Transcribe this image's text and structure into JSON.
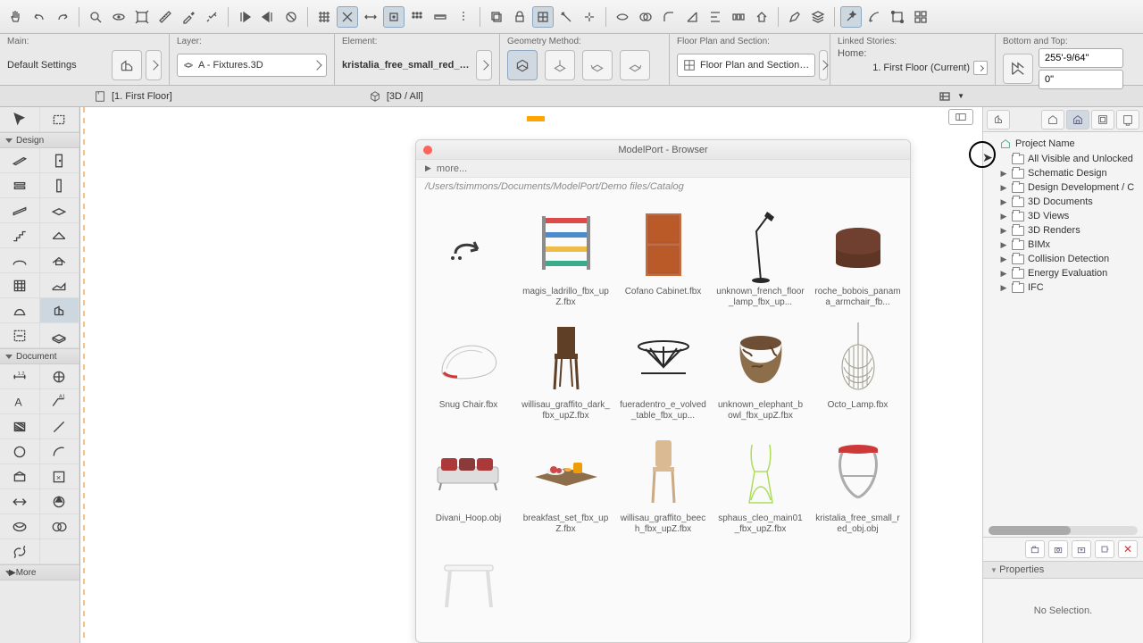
{
  "info": {
    "main_label": "Main:",
    "main_value": "Default Settings",
    "layer_label": "Layer:",
    "layer_value": "A - Fixtures.3D",
    "element_label": "Element:",
    "element_value": "kristalia_free_small_red_obj",
    "geometry_label": "Geometry Method:",
    "floorplan_label": "Floor Plan and Section:",
    "floorplan_value": "Floor Plan and Section…",
    "linked_label": "Linked Stories:",
    "linked_home": "Home:",
    "linked_story": "1. First Floor (Current)",
    "bottom_top_label": "Bottom and Top:",
    "top_value": "255'-9/64\"",
    "bottom_value": "0\""
  },
  "tabs": {
    "tab1": "[1. First Floor]",
    "tab2": "[3D / All]"
  },
  "toolbox": {
    "design": "Design",
    "document": "Document",
    "more": "More"
  },
  "browser": {
    "title": "ModelPort - Browser",
    "more": "more...",
    "path": "/Users/tsimmons/Documents/ModelPort/Demo files/Catalog",
    "items": [
      {
        "name": "",
        "svg": "arrow-loop"
      },
      {
        "name": "magis_ladrillo_fbx_upZ.fbx",
        "svg": "shelf"
      },
      {
        "name": "Cofano Cabinet.fbx",
        "svg": "cabinet"
      },
      {
        "name": "unknown_french_floor_lamp_fbx_up...",
        "svg": "lamp"
      },
      {
        "name": "roche_bobois_panama_armchair_fb...",
        "svg": "armchair"
      },
      {
        "name": "Snug Chair.fbx",
        "svg": "lounge"
      },
      {
        "name": "willisau_graffito_dark_fbx_upZ.fbx",
        "svg": "chair-dark"
      },
      {
        "name": "fueradentro_e_volved_table_fbx_up...",
        "svg": "table-wire"
      },
      {
        "name": "unknown_elephant_bowl_fbx_upZ.fbx",
        "svg": "bowl"
      },
      {
        "name": "Octo_Lamp.fbx",
        "svg": "pendant"
      },
      {
        "name": "Divani_Hoop.obj",
        "svg": "sofa"
      },
      {
        "name": "breakfast_set_fbx_upZ.fbx",
        "svg": "breakfast"
      },
      {
        "name": "willisau_graffito_beech_fbx_upZ.fbx",
        "svg": "chair-light"
      },
      {
        "name": "sphaus_cleo_main01_fbx_upZ.fbx",
        "svg": "wire-chair"
      },
      {
        "name": "kristalia_free_small_red_obj.obj",
        "svg": "stool"
      },
      {
        "name": "",
        "svg": "table-white"
      }
    ]
  },
  "tree": {
    "root": "Project Name",
    "visible": "All Visible and Unlocked",
    "items": [
      "Schematic Design",
      "Design Development / C",
      "3D Documents",
      "3D Views",
      "3D Renders",
      "BIMx",
      "Collision Detection",
      "Energy Evaluation",
      "IFC"
    ]
  },
  "props": {
    "header": "Properties",
    "noselect": "No Selection."
  }
}
